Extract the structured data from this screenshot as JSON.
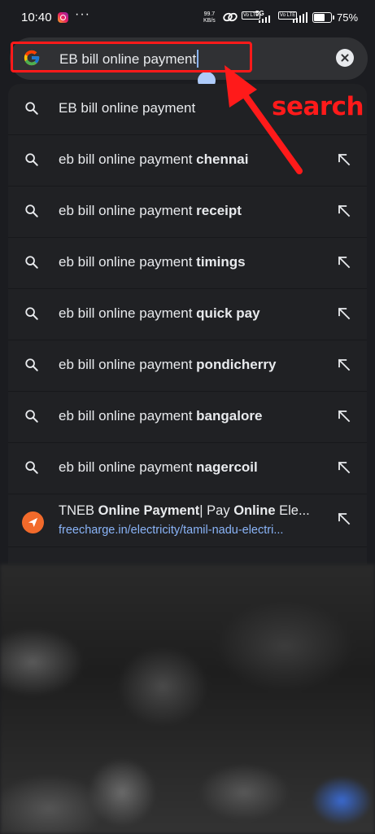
{
  "status_bar": {
    "time": "10:40",
    "more": "···",
    "net_speed_value": "99.7",
    "net_speed_unit": "KB/s",
    "volte1": "Vo LTE",
    "net_type": "5G",
    "volte2": "Vo LTE",
    "battery_percent": "75%",
    "battery_level": 0.75
  },
  "search": {
    "query": "EB bill online payment",
    "logo_icon": "google-g-icon",
    "clear_icon": "clear-icon"
  },
  "annotation": {
    "label": "search",
    "color": "#ff1a1a"
  },
  "suggestions": [
    {
      "prefix": "EB bill online payment",
      "bold": "",
      "has_arrow": false
    },
    {
      "prefix": "eb bill online payment ",
      "bold": "chennai",
      "has_arrow": true
    },
    {
      "prefix": "eb bill online payment ",
      "bold": "receipt",
      "has_arrow": true
    },
    {
      "prefix": "eb bill online payment ",
      "bold": "timings",
      "has_arrow": true
    },
    {
      "prefix": "eb bill online payment ",
      "bold": "quick pay",
      "has_arrow": true
    },
    {
      "prefix": "eb bill online payment ",
      "bold": "pondicherry",
      "has_arrow": true
    },
    {
      "prefix": "eb bill online payment ",
      "bold": "bangalore",
      "has_arrow": true
    },
    {
      "prefix": "eb bill online payment ",
      "bold": "nagercoil",
      "has_arrow": true
    }
  ],
  "site_suggestion": {
    "title_parts": [
      "TNEB ",
      "Online Payment",
      "| Pay ",
      "Online",
      " Ele..."
    ],
    "url": "freecharge.in/electricity/tamil-nadu-electri...",
    "icon": "freecharge-icon",
    "icon_color": "#f26a2b"
  },
  "colors": {
    "background": "#1b1c20",
    "panel": "#202124",
    "search_bar": "#303134",
    "link": "#8ab4f8",
    "accent_red": "#ff1a1a"
  }
}
